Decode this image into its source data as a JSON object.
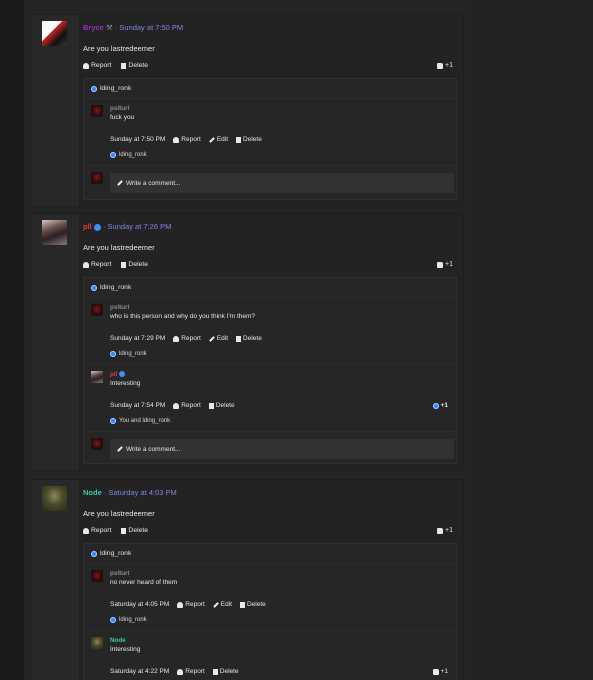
{
  "posts": [
    {
      "author": "Bryce",
      "author_color": "#9b2fbf",
      "time": "Sunday at 7:50 PM",
      "message": "Are you lastredeemer",
      "report": "Report",
      "delete": "Delete",
      "likes": "+1",
      "reaction_by": "lding_ronk",
      "comments": [
        {
          "author": "pslturl",
          "text": "fuck you",
          "time": "Sunday at 7:50 PM",
          "report": "Report",
          "edit": "Edit",
          "delete": "Delete",
          "reaction_by": "lding_ronk"
        }
      ],
      "write_comment": "Write a comment..."
    },
    {
      "author": "pll",
      "author_color": "#e23b3b",
      "time": "Sunday at 7:26 PM",
      "message": "Are you lastredeemer",
      "report": "Report",
      "delete": "Delete",
      "likes": "+1",
      "reaction_by": "lding_ronk",
      "comments": [
        {
          "author": "pslturl",
          "text": "who is this person and why do you think I'm them?",
          "time": "Sunday at 7:29 PM",
          "report": "Report",
          "edit": "Edit",
          "delete": "Delete",
          "reaction_by": "lding_ronk"
        },
        {
          "author": "pll",
          "text": "Interesting",
          "time": "Sunday at 7:54 PM",
          "report": "Report",
          "delete": "Delete",
          "likes": "+1",
          "reaction_by": "You and lding_ronk"
        }
      ],
      "write_comment": "Write a comment..."
    },
    {
      "author": "Node",
      "author_color": "#39c9a8",
      "time": "Saturday at 4:03 PM",
      "message": "Are you lastredeemer",
      "report": "Report",
      "delete": "Delete",
      "likes": "+1",
      "reaction_by": "lding_ronk",
      "comments": [
        {
          "author": "pslturl",
          "text": "no never heard of them",
          "time": "Saturday at 4:05 PM",
          "report": "Report",
          "edit": "Edit",
          "delete": "Delete",
          "reaction_by": "lding_ronk"
        },
        {
          "author": "Node",
          "text": "Interesting",
          "time": "Saturday at 4:22 PM",
          "report": "Report",
          "delete": "Delete",
          "likes": "+1"
        }
      ]
    }
  ]
}
